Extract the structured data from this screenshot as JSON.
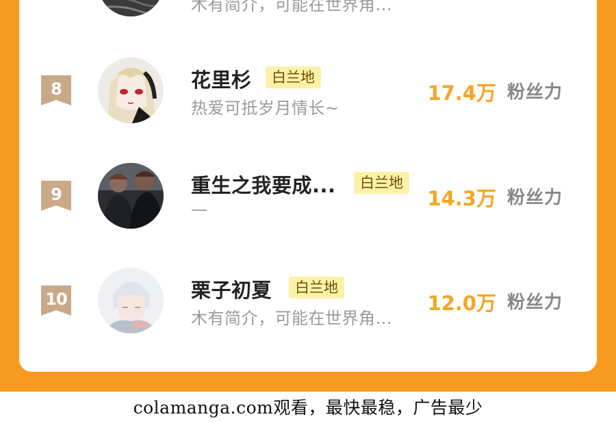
{
  "colors": {
    "page_orange": "#f99a20",
    "rank_badge": "#c9a98a",
    "fans_number": "#f5a623",
    "tag_bg": "#fdf1a9"
  },
  "top_partial": {
    "bio": "木有简介，可能在世界角..."
  },
  "rows": [
    {
      "rank": "8",
      "name": "花里杉",
      "tag": "白兰地",
      "bio": "热爱可抵岁月情长~",
      "fans_value": "17.4万",
      "fans_label": "粉丝力",
      "avatar_icon": "anime-girl-avatar"
    },
    {
      "rank": "9",
      "name": "重生之我要成...",
      "tag": "白兰地",
      "bio": "—",
      "fans_value": "14.3万",
      "fans_label": "粉丝力",
      "avatar_icon": "photo-people-avatar"
    },
    {
      "rank": "10",
      "name": "栗子初夏",
      "tag": "白兰地",
      "bio": "木有简介，可能在世界角...",
      "fans_value": "12.0万",
      "fans_label": "粉丝力",
      "avatar_icon": "anime-boy-avatar"
    }
  ],
  "footer": {
    "watermark": "colamanga.com观看，最快最稳，广告最少"
  }
}
